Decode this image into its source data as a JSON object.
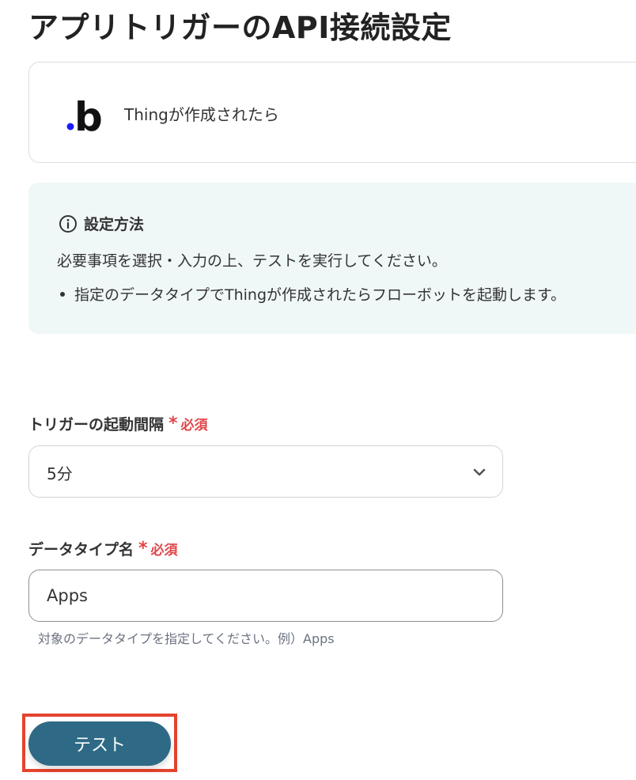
{
  "page": {
    "title": "アプリトリガーのAPI接続設定"
  },
  "trigger": {
    "app_icon": "bubble-logo-icon",
    "logo_letter": "b",
    "label": "Thingが作成されたら"
  },
  "info": {
    "icon": "info-circle-icon",
    "heading": "設定方法",
    "text": "必要事項を選択・入力の上、テストを実行してください。",
    "items": [
      "指定のデータタイプでThingが作成されたらフローボットを起動します。"
    ]
  },
  "fields": {
    "interval": {
      "label": "トリガーの起動間隔",
      "required_mark": "*",
      "required_text": "必須",
      "value": "5分",
      "icon": "chevron-down-icon"
    },
    "data_type": {
      "label": "データタイプ名",
      "required_mark": "*",
      "required_text": "必須",
      "value": "Apps",
      "help": "対象のデータタイプを指定してください。例）Apps"
    }
  },
  "actions": {
    "test_label": "テスト"
  },
  "colors": {
    "primary_button": "#2e6a86",
    "required": "#e0474a",
    "info_background": "#f0f7f7",
    "highlight": "#e5432d",
    "logo_dot": "#1a1aff"
  }
}
